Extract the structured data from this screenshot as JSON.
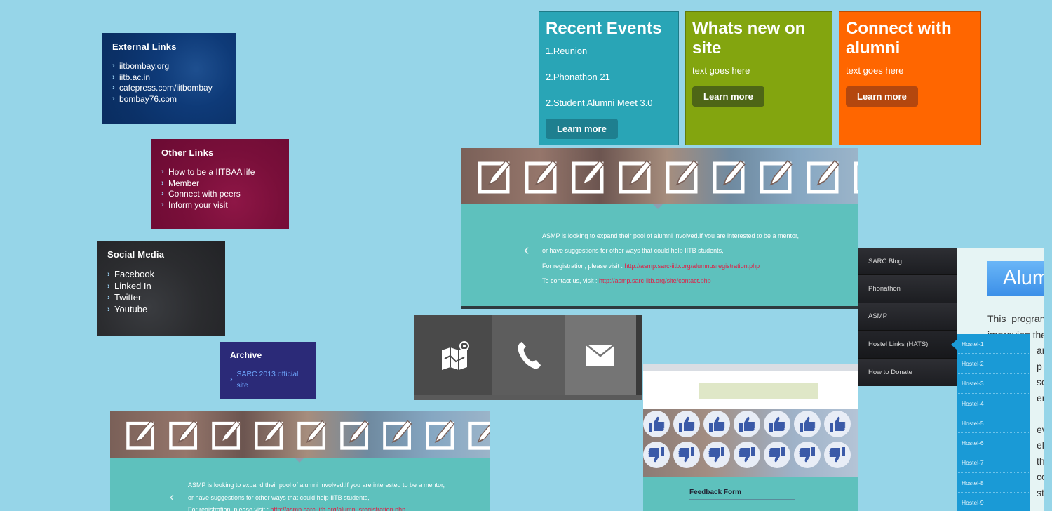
{
  "panels": {
    "external": {
      "title": "External Links",
      "items": [
        "iitbombay.org",
        "iitb.ac.in",
        "cafepress.com/iitbombay",
        "bombay76.com"
      ]
    },
    "other": {
      "title": "Other Links",
      "items": [
        "How to be a IITBAA life",
        "Member",
        "Connect with peers",
        "Inform your visit"
      ]
    },
    "social": {
      "title": "Social Media",
      "items": [
        "Facebook",
        "Linked In",
        "Twitter",
        "Youtube"
      ]
    },
    "archive": {
      "title": "Archive",
      "items": [
        "SARC 2013 official site"
      ]
    }
  },
  "tiles": {
    "events": {
      "title": "Recent Events",
      "items": [
        "1.Reunion",
        "2.Phonathon 21",
        "2.Student Alumni Meet 3.0"
      ],
      "button": "Learn more"
    },
    "whatsnew": {
      "title": "Whats new on site",
      "text": "text goes here",
      "button": "Learn more"
    },
    "connect": {
      "title": "Connect with alumni",
      "text": "text goes here",
      "button": "Learn more"
    }
  },
  "slider": {
    "line1": "ASMP is looking to expand their pool of alumni involved.If you are interested to be a mentor,",
    "line2": "or have suggestions for other ways that could help IITB students,",
    "line3_prefix": "For registration, please visit : ",
    "line3_link": "http://asmp.sarc-iitb.org/alumnusregistration.php",
    "line4_prefix": "To contact us, visit : ",
    "line4_link": "http://asmp.sarc-iitb.org/site/contact.php"
  },
  "contact_icons": [
    "map-icon",
    "phone-icon",
    "mail-icon"
  ],
  "thumb": {
    "form_title": "Feedback Form"
  },
  "menu": {
    "items": [
      "SARC Blog",
      "Phonathon",
      "ASMP",
      "Hostel Links (HATS)",
      "How to Donate"
    ],
    "submenu": [
      "Hostel-1",
      "Hostel-2",
      "Hostel-3",
      "Hostel-4",
      "Hostel-5",
      "Hostel-6",
      "Hostel-7",
      "Hostel-8",
      "Hostel-9"
    ]
  },
  "alumni": {
    "heading": "Alum",
    "text": "This  program  i\nimproving the A\n                  and\n                  p lo\n                  so h\n                  erati\n\n                  eves\n                  elop\n                  the\n                  com\n                  ster\n"
  },
  "colors": {
    "background": "#96d5e8",
    "events": "#29a5b6",
    "whatsnew": "#83a50f",
    "connect": "#ff6600",
    "link_red": "#e02047",
    "submenu": "#1a9ad6"
  }
}
